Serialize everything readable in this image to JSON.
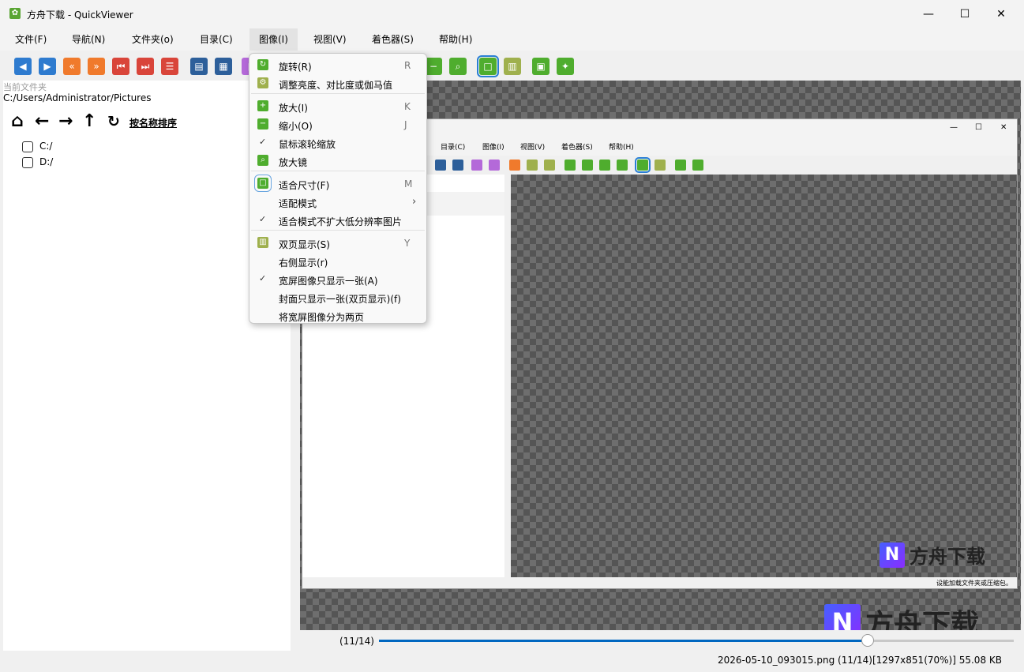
{
  "window": {
    "title": "方舟下载 - QuickViewer",
    "minimize": "—",
    "maximize": "☐",
    "close": "✕"
  },
  "menubar": [
    "文件(F)",
    "导航(N)",
    "文件夹(o)",
    "目录(C)",
    "图像(I)",
    "视图(V)",
    "着色器(S)",
    "帮助(H)"
  ],
  "left_panel": {
    "current_folder_label": "当前文件夹",
    "current_folder_path": "C:/Users/Administrator/Pictures",
    "sort_label": "按名称排序",
    "drives": [
      "C:/",
      "D:/"
    ]
  },
  "image_menu": {
    "items": [
      {
        "label": "旋转(R)",
        "key": "R",
        "icon": "rotate-icon"
      },
      {
        "label": "调整亮度、对比度或伽马值",
        "key": "",
        "icon": "gear-icon"
      },
      {
        "label": "放大(I)",
        "key": "K",
        "icon": "plus-icon"
      },
      {
        "label": "缩小(O)",
        "key": "J",
        "icon": "minus-icon"
      },
      {
        "label": "鼠标滚轮缩放",
        "key": "",
        "check": "✓"
      },
      {
        "label": "放大镜",
        "key": "",
        "icon": "magnifier-icon"
      },
      {
        "label": "适合尺寸(F)",
        "key": "M",
        "icon": "fit-icon"
      },
      {
        "label": "适配模式",
        "key": "",
        "arrow": "›"
      },
      {
        "label": "适合模式不扩大低分辨率图片",
        "key": "",
        "check": "✓"
      },
      {
        "label": "双页显示(S)",
        "key": "Y",
        "icon": "dual-page-icon"
      },
      {
        "label": "右侧显示(r)",
        "key": ""
      },
      {
        "label": "宽屏图像只显示一张(A)",
        "key": "",
        "check": "✓"
      },
      {
        "label": "封面只显示一张(双页显示)(f)",
        "key": ""
      },
      {
        "label": "将宽屏图像分为两页",
        "key": ""
      }
    ]
  },
  "inner_window": {
    "menubar": [
      "目录(C)",
      "图像(I)",
      "视图(V)",
      "着色器(S)",
      "帮助(H)"
    ],
    "status": "设能加载文件夹或压缩包。",
    "controls": {
      "minimize": "—",
      "maximize": "☐",
      "close": "✕"
    }
  },
  "watermark": {
    "text": "方舟下载"
  },
  "slider": {
    "page_indicator": "(11/14)",
    "position": 0.77
  },
  "statusbar": {
    "text": "2026-05-10_093015.png (11/14)[1297x851(70%)] 55.08 KB"
  },
  "colors": {
    "accent": "#0067c0",
    "green_icon": "#4fad2e",
    "blue_icon": "#2e7bcf",
    "orange_icon": "#f07a2c"
  }
}
